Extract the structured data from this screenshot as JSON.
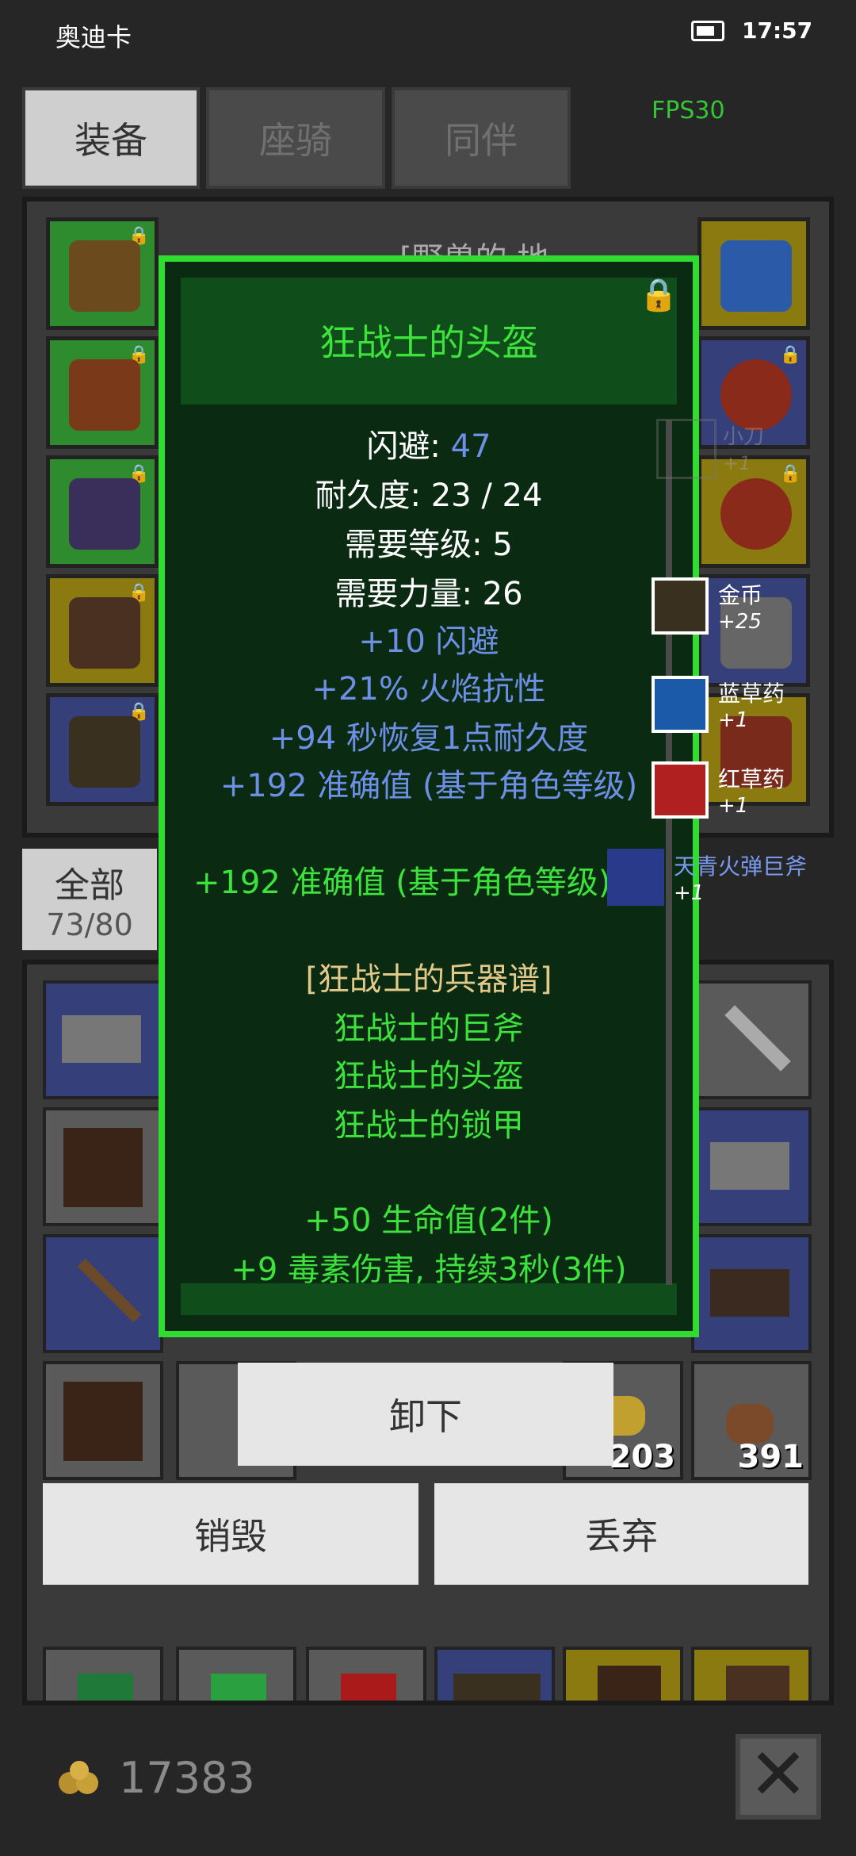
{
  "status_bar": {
    "carrier": "奥迪卡",
    "time": "17:57"
  },
  "tabs": [
    {
      "label": "装备",
      "active": true
    },
    {
      "label": "座骑",
      "active": false
    },
    {
      "label": "同伴",
      "active": false
    }
  ],
  "fps": "FPS30",
  "equipment_header": "[野兽的 地",
  "filter": {
    "label": "全部",
    "count": "73/80"
  },
  "tooltip": {
    "name": "狂战士的头盔",
    "stats": [
      {
        "label": "闪避:",
        "value": "47"
      },
      {
        "label": "耐久度: 23 / 24"
      },
      {
        "label": "需要等级: 5"
      },
      {
        "label": "需要力量: 26"
      }
    ],
    "bonuses": [
      "+10 闪避",
      "+21% 火焰抗性",
      "+94 秒恢复1点耐久度",
      "+192 准确值 (基于角色等级)"
    ],
    "set_bonus_line": "+192 准确值 (基于角色等级)(",
    "set_title": "[狂战士的兵器谱]",
    "set_items": [
      "狂战士的巨斧",
      "狂战士的头盔",
      "狂战士的锁甲"
    ],
    "set_effects": [
      "+50 生命值(2件)",
      "+9 毒素伤害, 持续3秒(3件)"
    ]
  },
  "side_label": {
    "name": "小刀",
    "count": "+1"
  },
  "pickups": [
    {
      "name": "金币",
      "count": "+25"
    },
    {
      "name": "蓝草药",
      "count": "+1"
    },
    {
      "name": "红草药",
      "count": "+1"
    },
    {
      "name": "天青火弹巨斧",
      "count": "+1"
    }
  ],
  "inventory_quantities": [
    "203",
    "391"
  ],
  "buttons": {
    "unequip": "卸下",
    "destroy": "销毁",
    "discard": "丢弃"
  },
  "footer": {
    "gold": "17383",
    "close": "✕"
  },
  "colors": {
    "accent_green": "#2fdc2f",
    "bonus_blue": "#6d8fe6",
    "set_gold": "#e2c98a"
  }
}
